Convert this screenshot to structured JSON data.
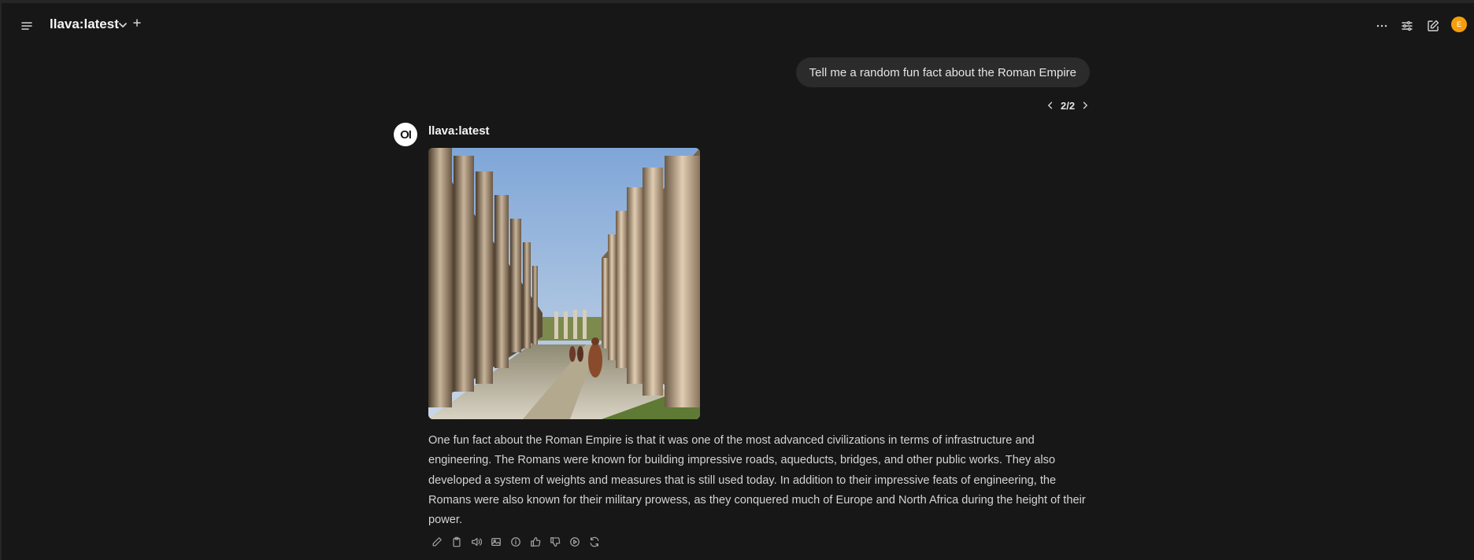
{
  "header": {
    "model_name": "llava:latest",
    "avatar_initial": "E"
  },
  "conversation": {
    "user_message": "Tell me a random fun fact about the Roman Empire",
    "pager": "2/2",
    "assistant": {
      "avatar_text": "OI",
      "model_name": "llava:latest",
      "reply": "One fun fact about the Roman Empire is that it was one of the most advanced civilizations in terms of infrastructure and engineering. The Romans were known for building impressive roads, aqueducts, bridges, and other public works. They also developed a system of weights and measures that is still used today. In addition to their impressive feats of engineering, the Romans were also known for their military prowess, as they conquered much of Europe and North Africa during the height of their power."
    }
  },
  "icons": {
    "menu": "menu-icon",
    "chevron": "chevron-down-icon",
    "plus": "plus-icon",
    "more": "ellipsis-icon",
    "controls": "sliders-icon",
    "new_chat": "edit-icon",
    "actions": [
      "pencil-icon",
      "clipboard-icon",
      "speaker-icon",
      "image-icon",
      "info-icon",
      "thumbs-up-icon",
      "thumbs-down-icon",
      "play-icon",
      "refresh-icon"
    ]
  },
  "colors": {
    "background": "#171717",
    "bubble": "#2b2b2b",
    "avatar_user": "#f59e0b"
  }
}
